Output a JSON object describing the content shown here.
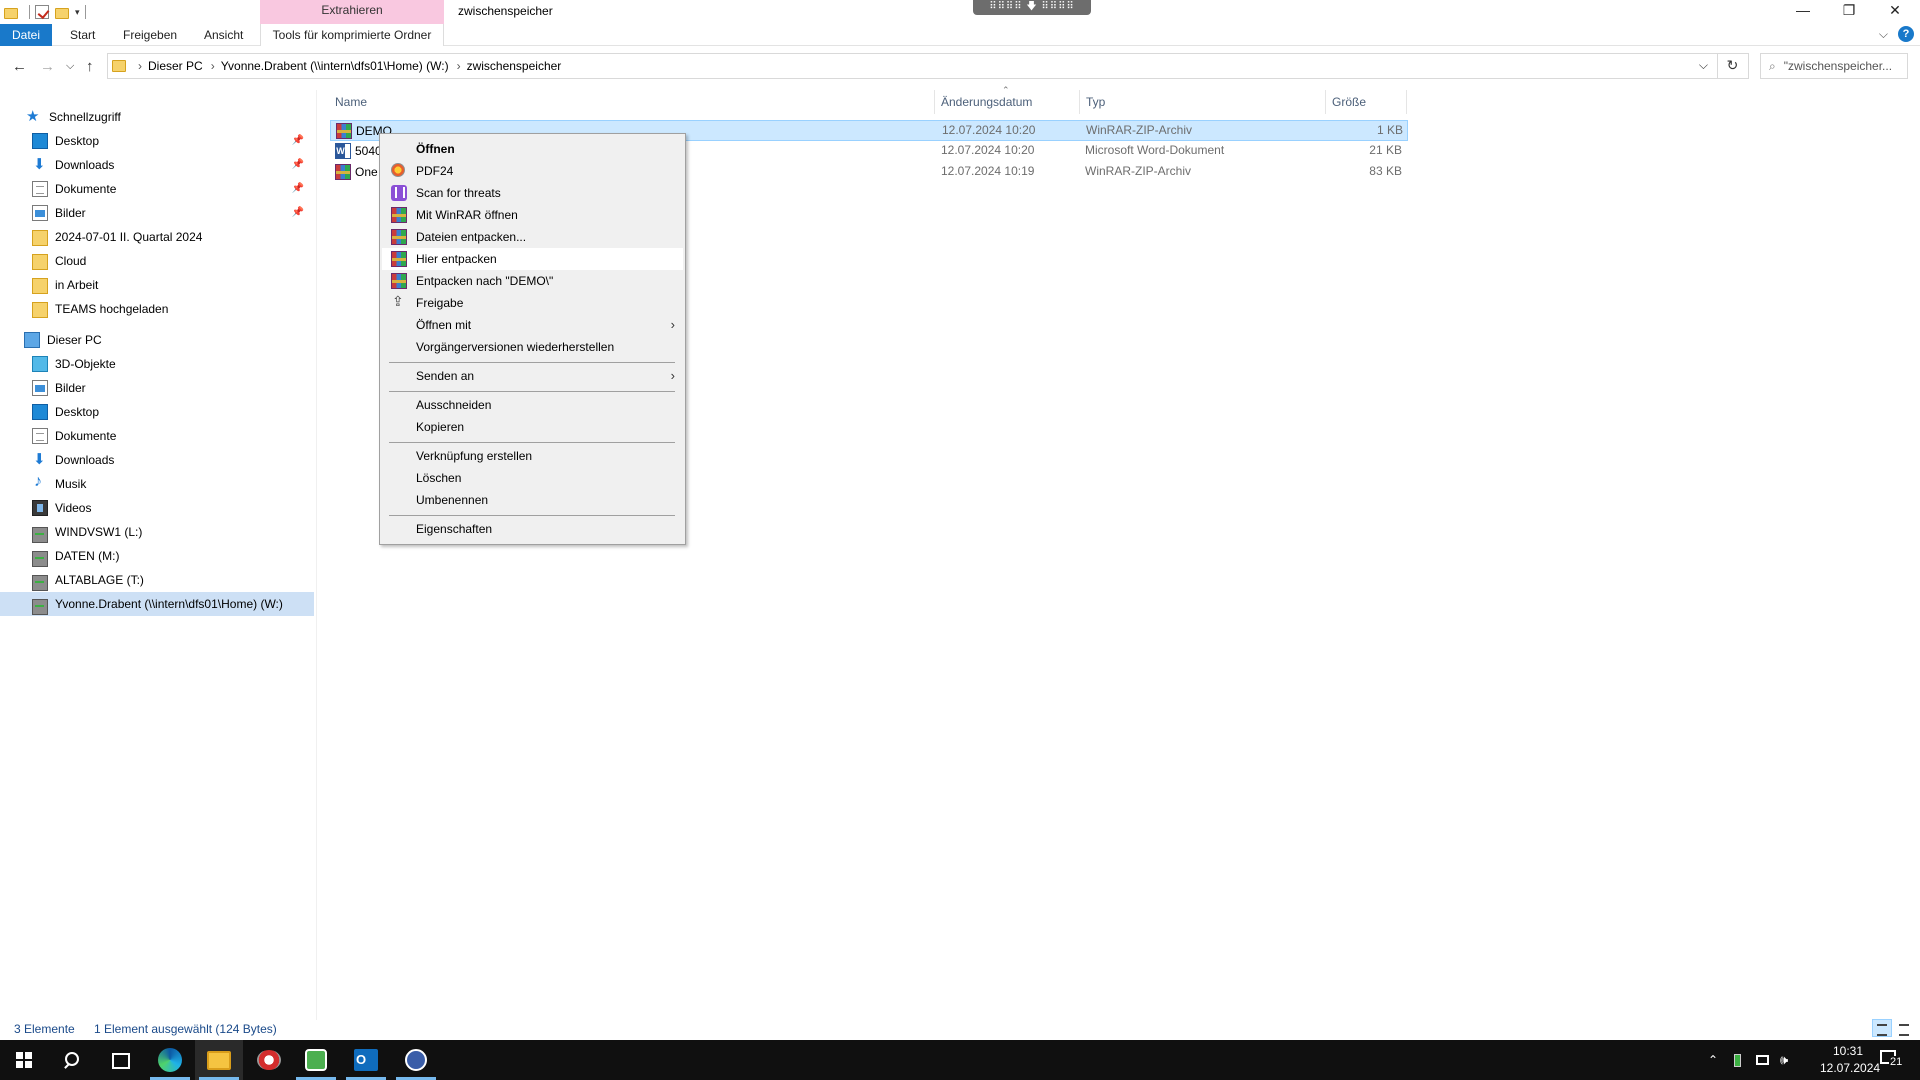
{
  "window": {
    "title": "zwischenspeicher",
    "context_tab_header": "Extrahieren",
    "drag_handle": "⠿⠿⠿⠿ 🡇 ⠿⠿⠿⠿",
    "minimize": "—",
    "maximize": "❐",
    "close": "✕"
  },
  "ribbon": {
    "tabs": [
      "Datei",
      "Start",
      "Freigeben",
      "Ansicht",
      "Tools für komprimierte Ordner"
    ],
    "help": "?",
    "collapse": "⌵"
  },
  "address": {
    "back": "←",
    "forward": "→",
    "recent": "⌵",
    "up": "↑",
    "crumbs": [
      "Dieser PC",
      "Yvonne.Drabent (\\\\intern\\dfs01\\Home) (W:)",
      "zwischenspeicher"
    ],
    "separator": "›",
    "dropdown": "⌵",
    "refresh": "↻",
    "search_placeholder": "\"zwischenspeicher...",
    "search_icon": "⌕"
  },
  "nav": {
    "quick_access": "Schnellzugriff",
    "quick_items": [
      {
        "label": "Desktop",
        "pinned": true
      },
      {
        "label": "Downloads",
        "pinned": true
      },
      {
        "label": "Dokumente",
        "pinned": true
      },
      {
        "label": "Bilder",
        "pinned": true
      },
      {
        "label": "2024-07-01 II. Quartal 2024"
      },
      {
        "label": "Cloud"
      },
      {
        "label": "in Arbeit"
      },
      {
        "label": "TEAMS hochgeladen"
      }
    ],
    "this_pc": "Dieser PC",
    "pc_items": [
      {
        "label": "3D-Objekte"
      },
      {
        "label": "Bilder"
      },
      {
        "label": "Desktop"
      },
      {
        "label": "Dokumente"
      },
      {
        "label": "Downloads"
      },
      {
        "label": "Musik"
      },
      {
        "label": "Videos"
      },
      {
        "label": "WINDVSW1 (L:)"
      },
      {
        "label": "DATEN (M:)"
      },
      {
        "label": "ALTABLAGE (T:)"
      },
      {
        "label": "Yvonne.Drabent (\\\\intern\\dfs01\\Home) (W:)",
        "selected": true
      }
    ],
    "pin_glyph": "📌"
  },
  "files": {
    "columns": [
      "Name",
      "Änderungsdatum",
      "Typ",
      "Größe"
    ],
    "sort_glyph": "⌃",
    "rows": [
      {
        "name": "DEMO",
        "date": "12.07.2024 10:20",
        "type": "WinRAR-ZIP-Archiv",
        "size": "1 KB",
        "icon": "winrar-icon",
        "selected": true
      },
      {
        "name": "5040",
        "date": "12.07.2024 10:20",
        "type": "Microsoft Word-Dokument",
        "size": "21 KB",
        "icon": "word-icon"
      },
      {
        "name": "One",
        "date": "12.07.2024 10:19",
        "type": "WinRAR-ZIP-Archiv",
        "size": "83 KB",
        "icon": "winrar-icon"
      }
    ]
  },
  "context_menu": {
    "items": [
      {
        "label": "Öffnen",
        "bold": true
      },
      {
        "label": "PDF24",
        "icon": "pdf24-icon"
      },
      {
        "label": "Scan for threats",
        "icon": "scan-icon"
      },
      {
        "label": "Mit WinRAR öffnen",
        "icon": "winrar-icon"
      },
      {
        "label": "Dateien entpacken...",
        "icon": "winrar-icon"
      },
      {
        "label": "Hier entpacken",
        "icon": "winrar-icon",
        "hover": true
      },
      {
        "label": "Entpacken nach \"DEMO\\\"",
        "icon": "winrar-icon"
      },
      {
        "label": "Freigabe",
        "icon": "share-icon"
      },
      {
        "label": "Öffnen mit",
        "submenu": true
      },
      {
        "label": "Vorgängerversionen wiederherstellen"
      },
      {
        "label": "Senden an",
        "submenu": true
      },
      {
        "label": "Ausschneiden"
      },
      {
        "label": "Kopieren"
      },
      {
        "label": "Verknüpfung erstellen"
      },
      {
        "label": "Löschen"
      },
      {
        "label": "Umbenennen"
      },
      {
        "label": "Eigenschaften"
      }
    ],
    "submenu_glyph": "›"
  },
  "status": {
    "count": "3 Elemente",
    "selection": "1 Element ausgewählt (124 Bytes)"
  },
  "taskbar": {
    "apps": [
      "start-icon",
      "search-icon",
      "task-view-icon",
      "edge-icon",
      "file-explorer-icon",
      "pdf24-icon",
      "green-app-icon",
      "outlook-icon",
      "lock-app-icon"
    ],
    "tray_chevron": "⌃",
    "time": "10:31",
    "date": "12.07.2024",
    "notification_count": "21"
  }
}
